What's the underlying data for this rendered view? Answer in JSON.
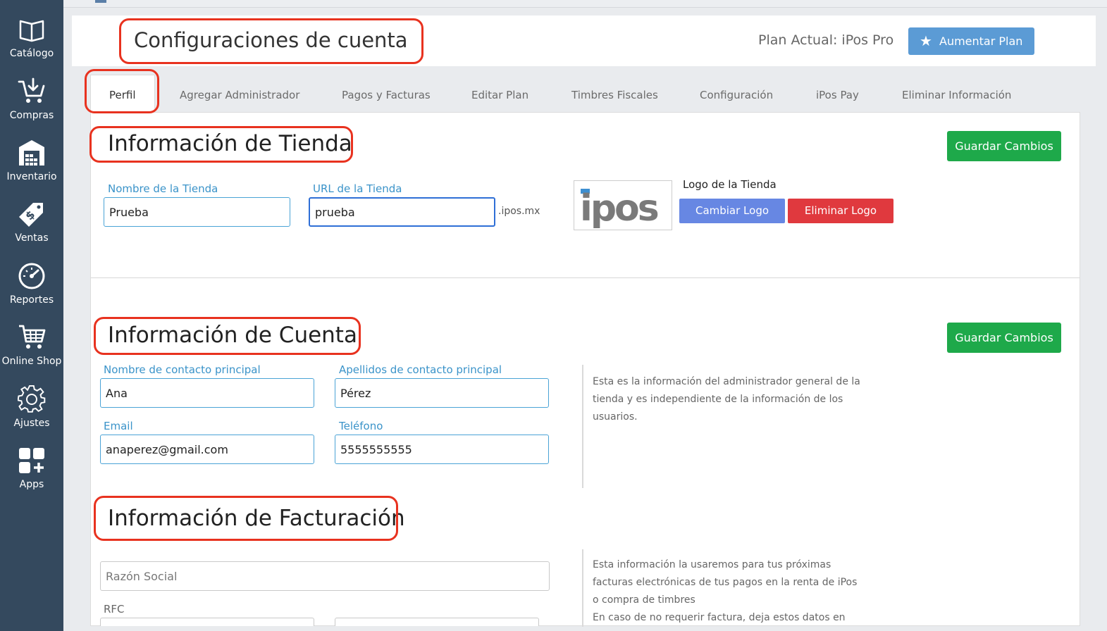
{
  "sidebar": {
    "items": [
      {
        "label": "Catálogo",
        "icon": "book-icon"
      },
      {
        "label": "Compras",
        "icon": "cart-download-icon"
      },
      {
        "label": "Inventario",
        "icon": "warehouse-icon"
      },
      {
        "label": "Ventas",
        "icon": "dollar-tag-icon"
      },
      {
        "label": "Reportes",
        "icon": "speedometer-icon"
      },
      {
        "label": "Online Shop",
        "icon": "shopping-cart-icon"
      },
      {
        "label": "Ajustes",
        "icon": "gear-icon"
      },
      {
        "label": "Apps",
        "icon": "apps-grid-icon"
      }
    ]
  },
  "header": {
    "title": "Configuraciones de cuenta",
    "plan_label": "Plan Actual: iPos Pro",
    "upgrade_button": "Aumentar Plan"
  },
  "tabs": [
    {
      "label": "Perfil",
      "active": true
    },
    {
      "label": "Agregar Administrador"
    },
    {
      "label": "Pagos y Facturas"
    },
    {
      "label": "Editar Plan"
    },
    {
      "label": "Timbres Fiscales"
    },
    {
      "label": "Configuración"
    },
    {
      "label": "iPos Pay"
    },
    {
      "label": "Eliminar Información"
    }
  ],
  "store_info": {
    "title": "Información de Tienda",
    "save_button": "Guardar Cambios",
    "store_name_label": "Nombre de la Tienda",
    "store_name_value": "Prueba",
    "store_url_label": "URL de la Tienda",
    "store_url_value": "prueba",
    "url_suffix": ".ipos.mx",
    "logo_label": "Logo de la Tienda",
    "logo_text": "ipos",
    "change_logo_button": "Cambiar Logo",
    "delete_logo_button": "Eliminar Logo"
  },
  "account_info": {
    "title": "Información de Cuenta",
    "save_button": "Guardar Cambios",
    "first_name_label": "Nombre de contacto principal",
    "first_name_value": "Ana",
    "last_name_label": "Apellidos de contacto principal",
    "last_name_value": "Pérez",
    "email_label": "Email",
    "email_value": "anaperez@gmail.com",
    "phone_label": "Teléfono",
    "phone_value": "5555555555",
    "help_lines": [
      "Esta es la información del administrador general de la",
      "tienda y es independiente de la información de los",
      "usuarios."
    ]
  },
  "billing_info": {
    "title": "Información de Facturación",
    "business_name_placeholder": "Razón Social",
    "rfc_label": "RFC",
    "help_lines": [
      "Esta información la usaremos para tus próximas",
      "facturas electrónicas de tus pagos en la renta de iPos",
      "o compra de timbres",
      "En caso de no requerir factura, deja estos datos en"
    ]
  },
  "colors": {
    "sidebar": "#34495e",
    "accent_blue": "#5b9bd5",
    "save_green": "#1ea94a",
    "delete_red": "#e0393e",
    "label_blue": "#3a93c9",
    "annotation_red": "#e8321f"
  }
}
